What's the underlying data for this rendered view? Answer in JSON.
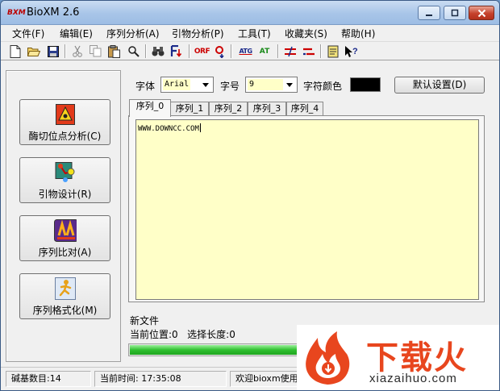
{
  "window": {
    "title": "BioXM 2.6",
    "icon": "bioxm-app-icon",
    "icon_text": "BXM"
  },
  "menu": [
    "文件(F)",
    "编辑(E)",
    "序列分析(A)",
    "引物分析(P)",
    "工具(T)",
    "收藏夹(S)",
    "帮助(H)"
  ],
  "toolbar": {
    "icons": [
      "new-file-icon",
      "open-folder-icon",
      "save-icon",
      "cut-icon",
      "copy-icon",
      "paste-icon",
      "find-replace-icon",
      "binoculars-icon",
      "find-next-icon",
      "orf-icon",
      "primer-icon",
      "atg-icon",
      "at-icon",
      "align-icon",
      "align-red-icon",
      "notes-icon",
      "help-pointer-icon"
    ],
    "orf_label": "ORF",
    "atg_label": "ATG",
    "at_label": "AT"
  },
  "left_panel": {
    "buttons": [
      {
        "label": "酶切位点分析(C)",
        "icon": "enzyme-icon"
      },
      {
        "label": "引物设计(R)",
        "icon": "primer-design-icon"
      },
      {
        "label": "序列比对(A)",
        "icon": "alignment-icon"
      },
      {
        "label": "序列格式化(M)",
        "icon": "format-runner-icon"
      }
    ]
  },
  "font_controls": {
    "font_label": "字体",
    "font_value": "Arial",
    "size_label": "字号",
    "size_value": "9",
    "color_label": "字符颜色",
    "color_value": "#000000",
    "default_button": "默认设置(D)"
  },
  "tabs": [
    "序列_0",
    "序列_1",
    "序列_2",
    "序列_3",
    "序列_4"
  ],
  "editor": {
    "text": "WWW.DOWNCC.COM",
    "background": "#ffffc8"
  },
  "info": {
    "file_status": "新文件",
    "position_label": "当前位置:",
    "position_value": "0",
    "selection_label": "选择长度:",
    "selection_value": "0",
    "progress": 0.5
  },
  "status": {
    "base_count": "碱基数目:14",
    "time": "当前时间: 17:35:08",
    "welcome": "欢迎bioxm使用本软件"
  },
  "watermark": {
    "title": "下载火",
    "subtitle": "xiazaihuo.com",
    "brand_color": "#e8461e"
  }
}
